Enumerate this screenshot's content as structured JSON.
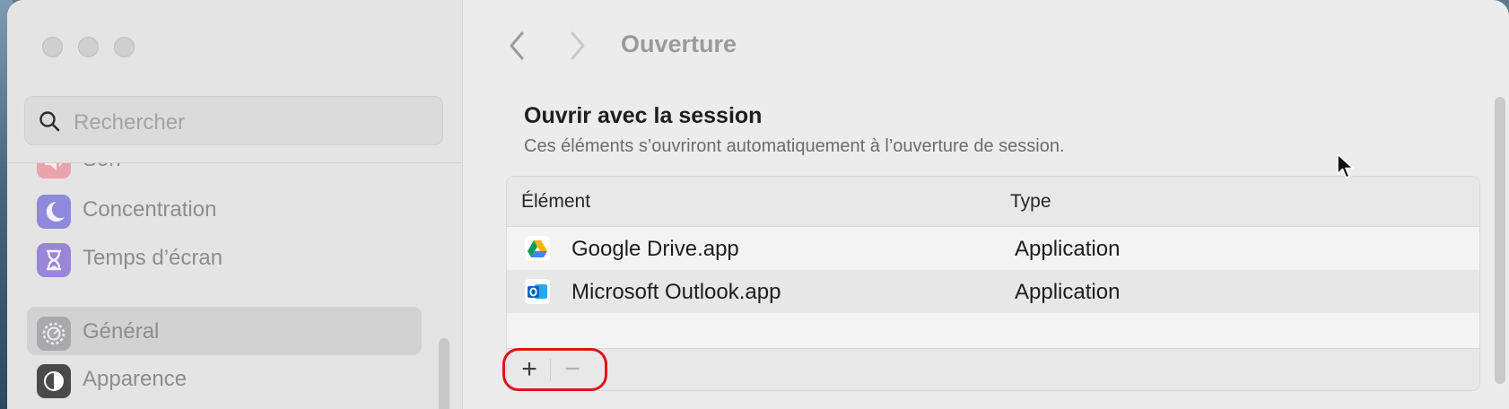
{
  "window": {
    "title": "Ouverture"
  },
  "sidebar": {
    "search": {
      "placeholder": "Rechercher"
    },
    "items": [
      {
        "label": "Son",
        "icon": "speaker-icon",
        "color": "#e36a77",
        "selected": false
      },
      {
        "label": "Concentration",
        "icon": "moon-icon",
        "color": "#6b63d6",
        "selected": false
      },
      {
        "label": "Temps d’écran",
        "icon": "hourglass-icon",
        "color": "#7a5fd1",
        "selected": false
      },
      {
        "label": "Général",
        "icon": "gear-icon",
        "color": "#8e8e93",
        "selected": true
      },
      {
        "label": "Apparence",
        "icon": "appearance-icon",
        "color": "#2c2c2e",
        "selected": false
      }
    ]
  },
  "main": {
    "nav": {
      "back_icon": "chevron-left-icon",
      "forward_icon": "chevron-right-icon"
    },
    "section": {
      "title": "Ouvrir avec la session",
      "subtitle": "Ces éléments s’ouvriront automatiquement à l’ouverture de session."
    },
    "table": {
      "columns": [
        "Élément",
        "Type"
      ],
      "rows": [
        {
          "name": "Google Drive.app",
          "type": "Application",
          "icon": "google-drive-icon"
        },
        {
          "name": "Microsoft Outlook.app",
          "type": "Application",
          "icon": "outlook-icon"
        }
      ],
      "add_label": "+",
      "remove_label": "−"
    }
  },
  "colors": {
    "highlight": "#e0121c"
  }
}
